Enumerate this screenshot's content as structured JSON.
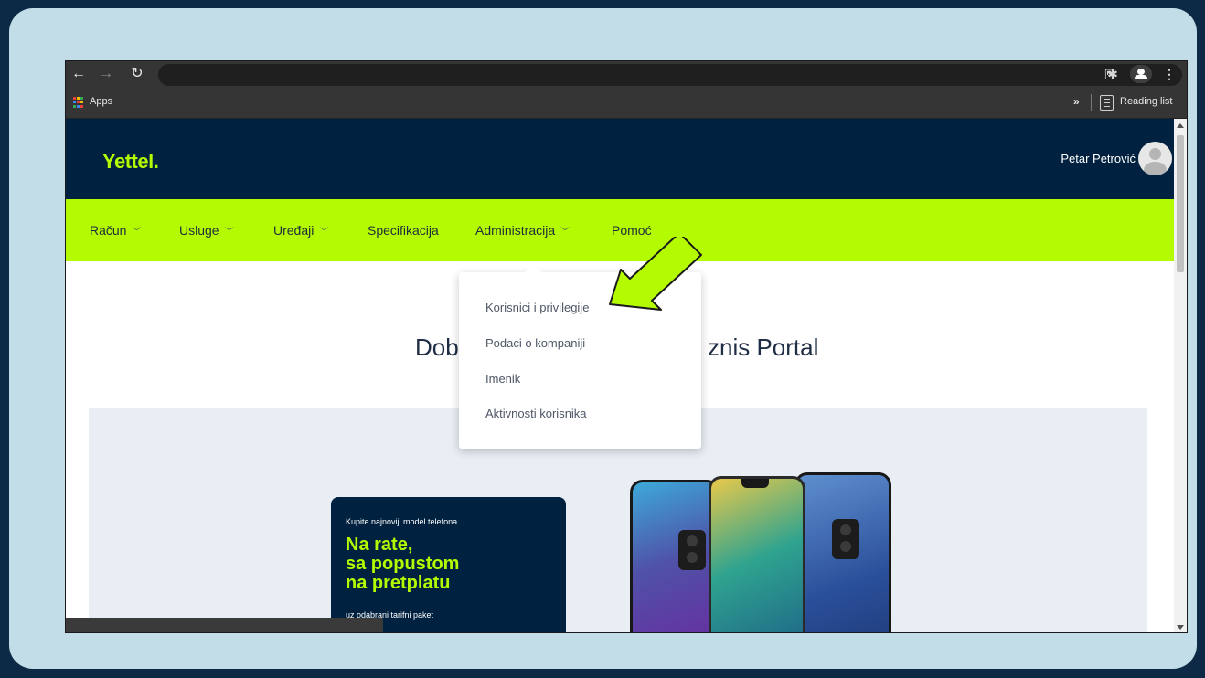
{
  "browser": {
    "bookmarks": {
      "apps_label": "Apps",
      "overflow_label": "»",
      "reading_list_label": "Reading list"
    }
  },
  "site": {
    "logo": "Yettel.",
    "user_name": "Petar Petrović",
    "nav": [
      {
        "label": "Račun",
        "has_dropdown": true
      },
      {
        "label": "Usluge",
        "has_dropdown": true
      },
      {
        "label": "Uređaji",
        "has_dropdown": true
      },
      {
        "label": "Specifikacija",
        "has_dropdown": false
      },
      {
        "label": "Administracija",
        "has_dropdown": true
      },
      {
        "label": "Pomoć",
        "has_dropdown": false
      }
    ],
    "dropdown": [
      "Korisnici i privilegije",
      "Podaci o kompaniji",
      "Imenik",
      "Aktivnosti korisnika"
    ],
    "welcome_left": "Dob",
    "welcome_right": "znis Portal",
    "promo": {
      "kicker": "Kupite najnoviji model telefona",
      "headline": [
        "Na rate,",
        "sa popustom",
        "na pretplatu"
      ],
      "footnote": "uz odabrani tarifni paket"
    }
  },
  "icons": {
    "back": "arrow-left-icon",
    "forward": "arrow-right-icon",
    "reload": "reload-icon",
    "share": "share-icon",
    "bookmark": "star-icon",
    "extensions": "puzzle-icon",
    "profile": "profile-icon",
    "menu": "kebab-menu-icon",
    "annotation": "annotation-arrow-icon"
  },
  "colors": {
    "brand_lime": "#b4fa00",
    "brand_navy": "#00213f",
    "frame_background": "#c3dde8",
    "outer_background": "#0c2a45"
  }
}
